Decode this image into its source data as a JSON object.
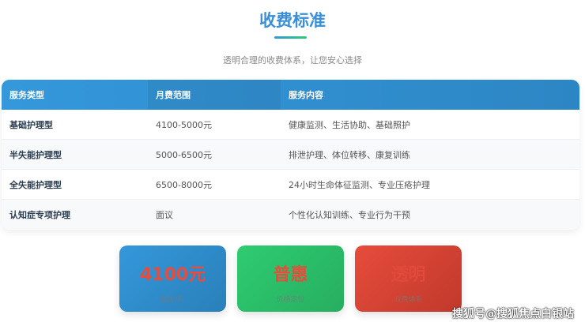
{
  "header": {
    "title": "收费标准",
    "subtitle": "透明合理的收费体系，让您安心选择"
  },
  "table": {
    "columns": [
      "服务类型",
      "月费范围",
      "服务内容"
    ],
    "rows": [
      [
        "基础护理型",
        "4100-5000元",
        "健康监测、生活协助、基础照护"
      ],
      [
        "半失能护理型",
        "5000-6500元",
        "排泄护理、体位转移、康复训练"
      ],
      [
        "全失能护理型",
        "6500-8000元",
        "24小时生命体征监测、专业压疮护理"
      ],
      [
        "认知症专项护理",
        "面议",
        "个性化认知训练、专业行为干预"
      ]
    ]
  },
  "cards": [
    {
      "value": "4100元",
      "label": "起价/月",
      "color": "#3498db"
    },
    {
      "value": "普惠",
      "label": "价格定位",
      "color": "#2ecc71"
    },
    {
      "value": "透明",
      "label": "收费体系",
      "color": "#e74c3c"
    }
  ],
  "watermark": "搜狐号@搜狐焦点白银站"
}
